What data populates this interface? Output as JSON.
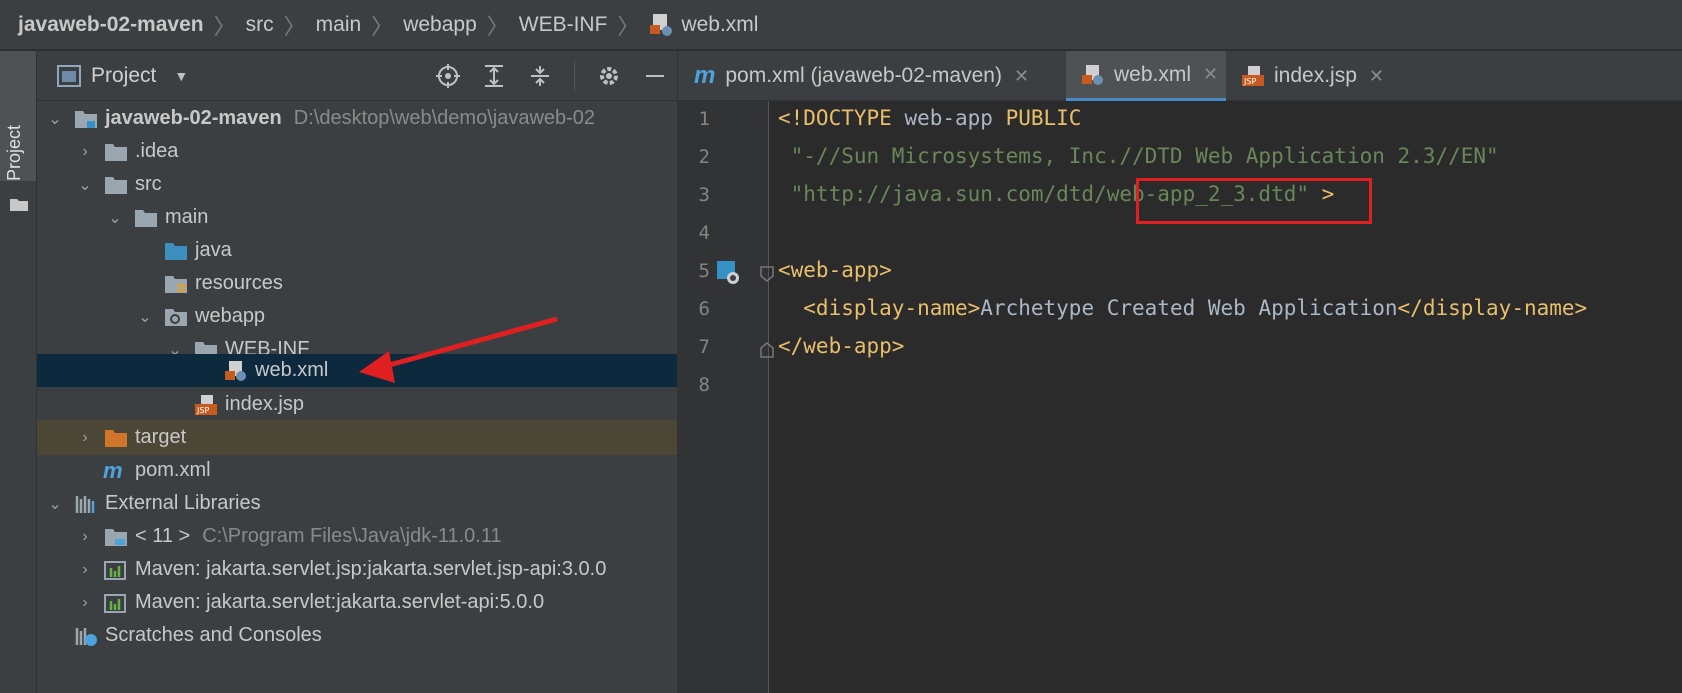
{
  "breadcrumb": {
    "items": [
      "javaweb-02-maven",
      "src",
      "main",
      "webapp",
      "WEB-INF",
      "web.xml"
    ]
  },
  "sidebar": {
    "tab_label": "Project",
    "header_title": "Project"
  },
  "tree": {
    "root_name": "javaweb-02-maven",
    "root_path": "D:\\desktop\\web\\demo\\javaweb-02",
    "idea": ".idea",
    "src": "src",
    "main": "main",
    "java": "java",
    "resources": "resources",
    "webapp": "webapp",
    "webinf": "WEB-INF",
    "webxml": "web.xml",
    "indexjsp": "index.jsp",
    "target": "target",
    "pomxml": "pom.xml",
    "external_libraries": "External Libraries",
    "jdk_name": "< 11 >",
    "jdk_path": "C:\\Program Files\\Java\\jdk-11.0.11",
    "lib1": "Maven: jakarta.servlet.jsp:jakarta.servlet.jsp-api:3.0.0",
    "lib2": "Maven: jakarta.servlet:jakarta.servlet-api:5.0.0",
    "scratches": "Scratches and Consoles"
  },
  "tabs": [
    {
      "label": "pom.xml (javaweb-02-maven)"
    },
    {
      "label": "web.xml"
    },
    {
      "label": "index.jsp"
    }
  ],
  "editor": {
    "line_numbers": [
      "1",
      "2",
      "3",
      "4",
      "5",
      "6",
      "7",
      "8"
    ],
    "l1_kw": "<!DOCTYPE",
    "l1_txt": " web-app ",
    "l1_kw2": "PUBLIC",
    "l2_str": " \"-//Sun Microsystems, Inc.//DTD Web Application 2.3//EN\"",
    "l3_str": " \"http://java.sun.com/dtd/web-app_2_3.dtd\"",
    "l3_end": " >",
    "l5_tag": "<web-app>",
    "l6_open": "  <display-name>",
    "l6_text": "Archetype Created Web Application",
    "l6_close": "</display-name>",
    "l7_tag": "</web-app>"
  },
  "colors": {
    "annotation_red": "#e02020",
    "selection": "#0d293e",
    "tag": "#e8bf6a",
    "string": "#6a8759"
  }
}
